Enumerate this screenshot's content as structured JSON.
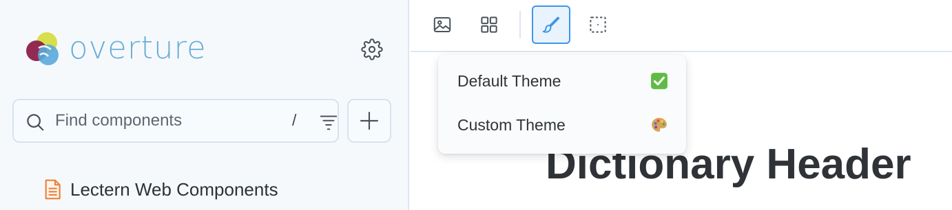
{
  "sidebar": {
    "logo": {
      "text": "overture",
      "colors": {
        "yellow": "#d7df4a",
        "maroon": "#8c1f4b",
        "blue": "#5aa9dc",
        "text": "#6aaed6"
      }
    },
    "settings_icon": "gear-icon",
    "search": {
      "placeholder": "Find components",
      "value": "",
      "shortcut_hint": "/",
      "filter_icon": "filter-icon"
    },
    "add_icon": "plus-icon",
    "tree": {
      "items": [
        {
          "label": "Lectern Web Components",
          "icon": "document-icon",
          "icon_color": "#e8823a"
        }
      ]
    }
  },
  "toolbar": {
    "buttons": [
      {
        "name": "image",
        "icon": "image-icon",
        "active": false
      },
      {
        "name": "grid",
        "icon": "grid-icon",
        "active": false
      },
      {
        "name": "theme",
        "icon": "paintbrush-icon",
        "active": true
      },
      {
        "name": "outline",
        "icon": "outline-icon",
        "active": false
      }
    ],
    "accent": "#3d96e9"
  },
  "theme_menu": {
    "items": [
      {
        "label": "Default Theme",
        "icon": "check-mark-icon"
      },
      {
        "label": "Custom Theme",
        "icon": "palette-icon"
      }
    ]
  },
  "preview": {
    "heading": "Dictionary Header"
  }
}
